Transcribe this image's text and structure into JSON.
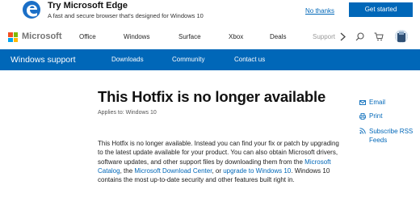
{
  "banner": {
    "title": "Try Microsoft Edge",
    "subtitle": "A fast and secure browser that's designed for Windows 10",
    "no_thanks": "No thanks",
    "get_started": "Get started"
  },
  "header": {
    "brand": "Microsoft",
    "nav": [
      "Office",
      "Windows",
      "Surface",
      "Xbox",
      "Deals",
      "Support"
    ],
    "next_icon": "chevron-right-icon",
    "search_icon": "search-icon",
    "cart_icon": "cart-icon"
  },
  "support_bar": {
    "title": "Windows support",
    "links": [
      "Downloads",
      "Community",
      "Contact us"
    ]
  },
  "article": {
    "title": "This Hotfix is no longer available",
    "applies_to": "Applies to: Windows 10",
    "body_1": "This Hotfix is no longer available.  Instead you can find your fix or patch by upgrading to the latest update available for your product. You can also obtain Microsoft drivers, software updates, and other support files by downloading them from the ",
    "link_catalog": "Microsoft Catalog",
    "body_2": ", the ",
    "link_download": "Microsoft Download Center",
    "body_3": ", or ",
    "link_upgrade": "upgrade to Windows 10",
    "body_4": ". Windows 10 contains the most up-to-date security and other features built right in."
  },
  "share": {
    "email": "Email",
    "print": "Print",
    "rss": "Subscribe RSS Feeds"
  },
  "colors": {
    "accent": "#0067b8"
  }
}
